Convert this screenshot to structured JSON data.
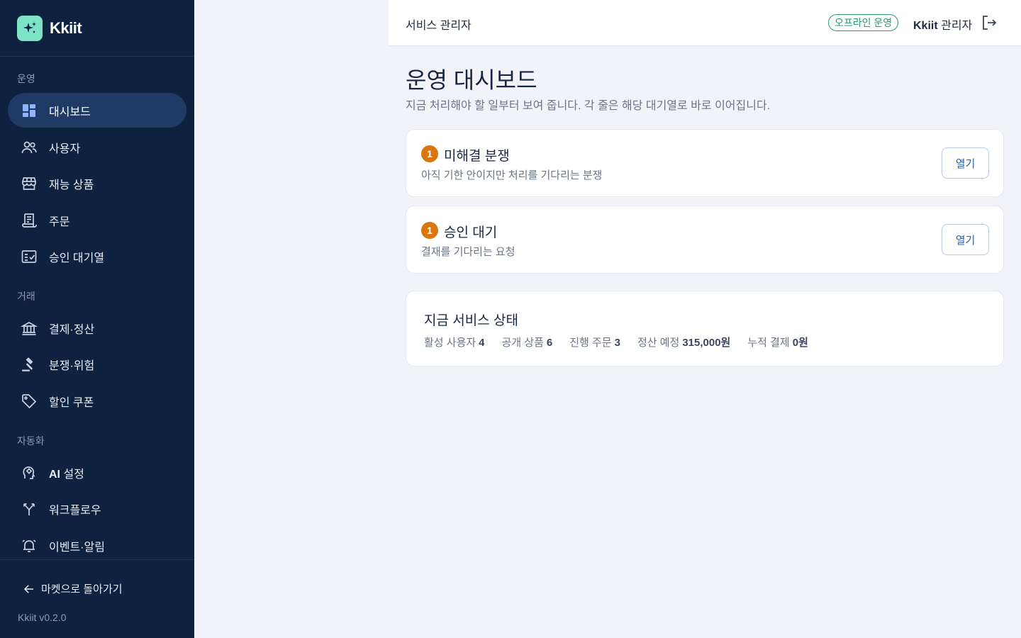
{
  "brand": {
    "name": "Kkiit"
  },
  "sidebar": {
    "sections": [
      {
        "title": "운영"
      },
      {
        "title": "거래"
      },
      {
        "title": "자동화"
      }
    ],
    "items": [
      {
        "label": "대시보드",
        "icon": "dashboard-icon",
        "active": true
      },
      {
        "label": "사용자",
        "icon": "users-icon"
      },
      {
        "label": "재능 상품",
        "icon": "store-icon"
      },
      {
        "label": "주문",
        "icon": "receipt-icon"
      },
      {
        "label": "승인 대기열",
        "icon": "approval-checklist-icon"
      },
      {
        "label": "결제·정산",
        "icon": "bank-icon"
      },
      {
        "label": "분쟁·위험",
        "icon": "gavel-icon"
      },
      {
        "label": "할인 쿠폰",
        "icon": "tag-icon"
      },
      {
        "label_bold": "AI",
        "label": " 설정",
        "icon": "ai-brain-icon"
      },
      {
        "label": "워크플로우",
        "icon": "workflow-fork-icon"
      },
      {
        "label": "이벤트·알림",
        "icon": "alarm-bell-icon"
      }
    ],
    "back_label": "마켓으로 돌아가기",
    "version": "Kkiit v0.2.0"
  },
  "header": {
    "title": "서비스 관리자",
    "status_badge": "오프라인 운영",
    "admin_brand": "Kkiit",
    "admin_role": " 관리자"
  },
  "main": {
    "title": "운영 대시보드",
    "subtitle": "지금 처리해야 할 일부터 보여 줍니다. 각 줄은 해당 대기열로 바로 이어집니다.",
    "tasks": [
      {
        "count": "1",
        "title": "미해결 분쟁",
        "desc": "아직 기한 안이지만 처리를 기다리는 분쟁",
        "button": "열기"
      },
      {
        "count": "1",
        "title": "승인 대기",
        "desc": "결재를 기다리는 요청",
        "button": "열기"
      }
    ],
    "status": {
      "title": "지금 서비스 상태",
      "stats": [
        {
          "label": "활성 사용자",
          "value": "4"
        },
        {
          "label": "공개 상품",
          "value": "6"
        },
        {
          "label": "진행 주문",
          "value": "3"
        },
        {
          "label": "정산 예정",
          "value": "315,000원"
        },
        {
          "label": "누적 결제",
          "value": "0원"
        }
      ]
    }
  },
  "colors": {
    "sidebar_bg": "#0e213f",
    "active_item_bg": "#1f3a64",
    "brand_accent": "#7ee3c4",
    "badge_orange": "#d9770e",
    "status_green": "#2c9a6c",
    "button_blue": "#2f5fad"
  }
}
